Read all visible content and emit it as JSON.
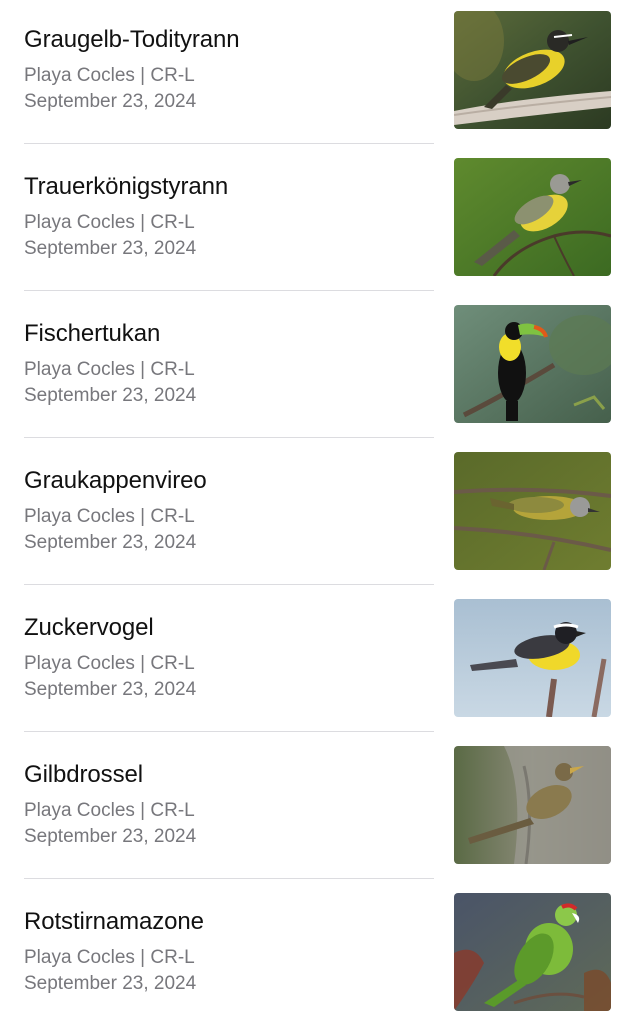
{
  "sightings": [
    {
      "name": "Graugelb-Todityrann",
      "location": "Playa Cocles | CR-L",
      "date": "September 23, 2024",
      "photo": "yellow-bellied-flycatcher-on-branch"
    },
    {
      "name": "Trauerkönigstyrann",
      "location": "Playa Cocles | CR-L",
      "date": "September 23, 2024",
      "photo": "tropical-kingbird-on-twig"
    },
    {
      "name": "Fischertukan",
      "location": "Playa Cocles | CR-L",
      "date": "September 23, 2024",
      "photo": "keel-billed-toucan-on-branch"
    },
    {
      "name": "Graukappenvireo",
      "location": "Playa Cocles | CR-L",
      "date": "September 23, 2024",
      "photo": "vireo-on-branch"
    },
    {
      "name": "Zuckervogel",
      "location": "Playa Cocles | CR-L",
      "date": "September 23, 2024",
      "photo": "bananaquit-on-branch"
    },
    {
      "name": "Gilbdrossel",
      "location": "Playa Cocles | CR-L",
      "date": "September 23, 2024",
      "photo": "brown-thrush-on-trunk"
    },
    {
      "name": "Rotstirnamazone",
      "location": "Playa Cocles | CR-L",
      "date": "September 23, 2024",
      "photo": "green-parrot-in-tree"
    }
  ]
}
